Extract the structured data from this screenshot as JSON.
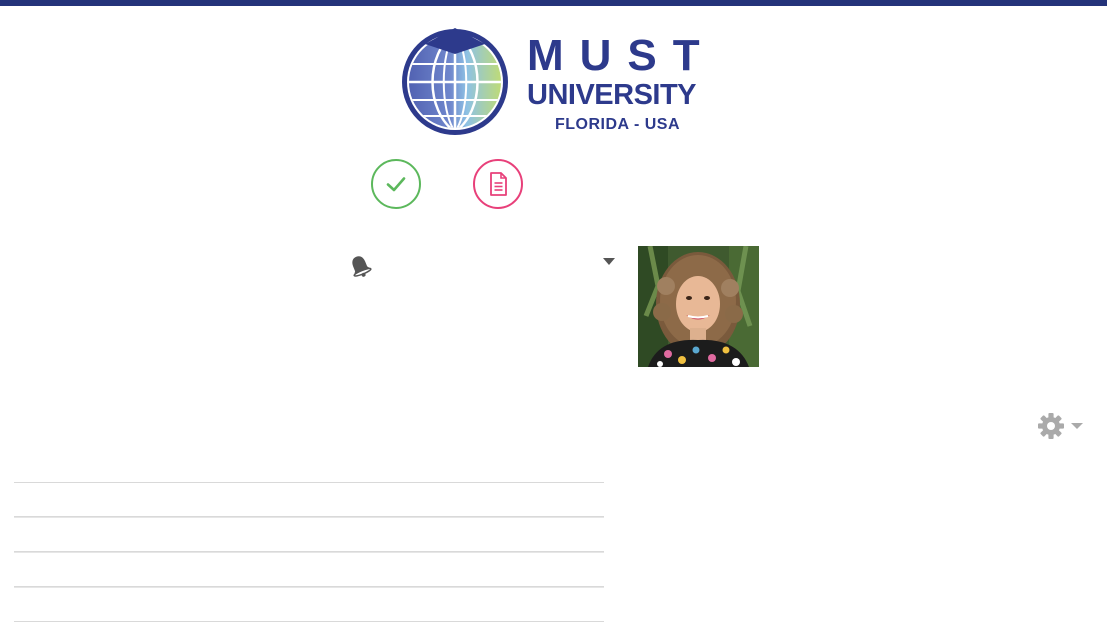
{
  "brand": {
    "name_line1": "MUST",
    "name_line2": "UNIVERSITY",
    "name_line3": "FLORIDA - USA",
    "primary_color": "#2d3a8c",
    "topbar_color": "#24337a"
  },
  "actions": [
    {
      "icon": "check-icon",
      "color": "#5cb85c"
    },
    {
      "icon": "document-icon",
      "color": "#e8407a"
    }
  ],
  "header": {
    "notifications_icon": "bell-icon",
    "user_menu_icon": "caret-down-icon"
  },
  "profile": {
    "avatar": "user-photo"
  },
  "settings": {
    "icon": "gear-icon"
  },
  "list": {
    "rows": [
      "",
      "",
      "",
      ""
    ]
  }
}
